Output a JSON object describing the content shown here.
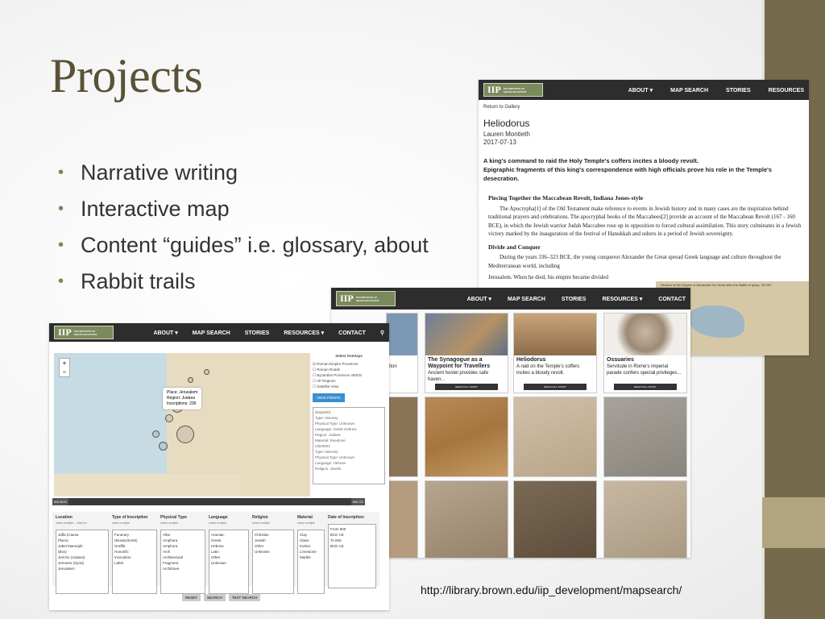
{
  "slide": {
    "title": "Projects",
    "bullets": [
      "Narrative writing",
      "Interactive map",
      "Content “guides” i.e. glossary, about",
      "Rabbit trails"
    ],
    "url": "http://library.brown.edu/iip_development/mapsearch/"
  },
  "site": {
    "logo_mark": "IIP",
    "logo_text": "INSCRIPTIONS OF ISRAEL/PALESTINE",
    "nav": [
      "ABOUT ▾",
      "MAP SEARCH",
      "STORIES",
      "RESOURCES"
    ],
    "nav_full": [
      "ABOUT ▾",
      "MAP SEARCH",
      "STORIES",
      "RESOURCES ▾",
      "CONTACT"
    ]
  },
  "article": {
    "back": "Return to Gallery",
    "title": "Heliodorus",
    "author": "Lauren Montieth",
    "date": "2017-07-13",
    "lede1": "A king's command to raid the Holy Temple's coffers incites a bloody revolt.",
    "lede2": "Epigraphic fragments of this king's correspondence with high officials prove his role in the Temple's desecration.",
    "sec1_title": "Piecing Together the Maccabean Revolt, Indiana Jones-style",
    "sec1_text": "The Apocrypha[1] of the Old Testament make reference to events in Jewish history and in many cases are the inspiration behind traditional prayers and celebrations. The apocryphal books of the Maccabees[2] provide an account of the Maccabean Revolt (167 - 160 BCE), in which the Jewish warrior Judah Maccabee rose up in opposition to forced cultural assimilation. This story culminates in a Jewish victory marked by the inauguration of the festival of Hanukkah and ushers in a period of Jewish sovereignty.",
    "sec2_title": "Divide and Conquer",
    "sec2_text": "During the years 336–323 BCE, the young conqueror Alexander the Great spread Greek language and culture throughout the Mediterranean world, including",
    "sec2_more": "Jerusalem. When he died, his empire became divided",
    "map_caption": "Division of the Empire of Alexander the Great after the Battle of Ipsus, 301 BC"
  },
  "gallery": {
    "stories": [
      {
        "title": "",
        "text": "tion"
      },
      {
        "title": "The Synagogue as a Waypoint for Travellers",
        "text": "Ancient hostel provides safe haven..."
      },
      {
        "title": "Heliodorus",
        "text": "A raid on the Temple's coffers incites a bloody revolt."
      },
      {
        "title": "Ossuaries",
        "text": "Servitude in Rome's imperial parade confers special privileges..."
      }
    ],
    "read_label": "READ FULL STORY"
  },
  "mapsearch": {
    "popup_place": "Place: Jerusalem",
    "popup_region": "Region: Judaea",
    "popup_count": "Inscriptions: 236",
    "overlays_title": "Select Overlays",
    "overlays": [
      "Roman Empire Provinces",
      "Roman Roads",
      "Byzantine Provinces 400CE",
      "IIP Regions",
      "Satellite View"
    ],
    "view_points": "VIEW POINTS",
    "list_items": [
      "ahap0001",
      "Type: Itinerary",
      "Physical Type: Unknown",
      "Language: Greek Hebrew",
      "Region: Judaea",
      "Material: limestone",
      "mbe0001",
      "Type: Itinerary",
      "Physical Type: Unknown",
      "Language: Hebrew",
      "Religion: Jewish"
    ],
    "time_start": "600 BCE",
    "time_end": "650 CE",
    "filters": [
      {
        "h": "Location",
        "s": "select multiple – clear/no",
        "items": [
          "Jaffa (Caesa",
          "Place)",
          "Jabel Mareejah",
          "(Bos)",
          "Jericho (Judaea)",
          "Jermane (Syria)",
          "Jerusalem"
        ]
      },
      {
        "h": "Type of Inscription",
        "s": "select multiple",
        "items": [
          "Funerary",
          "(Mosaic/tomb)",
          "Graffiti",
          "Honorific",
          "Invocation",
          "Label"
        ]
      },
      {
        "h": "Physical Type",
        "s": "select multiple",
        "items": [
          "Altar",
          "Amphora",
          "Amphora",
          "Arch",
          "Architectural",
          "Fragment",
          "Architrave"
        ]
      },
      {
        "h": "Language",
        "s": "select multiple",
        "items": [
          "Aramaic",
          "Greek",
          "Hebrew",
          "Latin",
          "Other",
          "Unknown"
        ]
      },
      {
        "h": "Religion",
        "s": "select multiple",
        "items": [
          "Christian",
          "Jewish",
          "Other",
          "Unknown"
        ]
      },
      {
        "h": "Material",
        "s": "select multiple",
        "items": [
          "Clay",
          "Glass",
          "Kurkar",
          "Limestone",
          "Marble"
        ]
      },
      {
        "h": "Date of Inscription:",
        "s": "",
        "items": [
          "From 600",
          "BCE  CE",
          "To 650",
          "BCE  CE"
        ]
      }
    ],
    "buttons": [
      "RESET",
      "SEARCH",
      "TEXT SEARCH"
    ]
  },
  "colors": {
    "accent": "#766a4d",
    "accent_light": "#b0a57f",
    "title": "#5a5236",
    "logo": "#7b8a5d"
  }
}
